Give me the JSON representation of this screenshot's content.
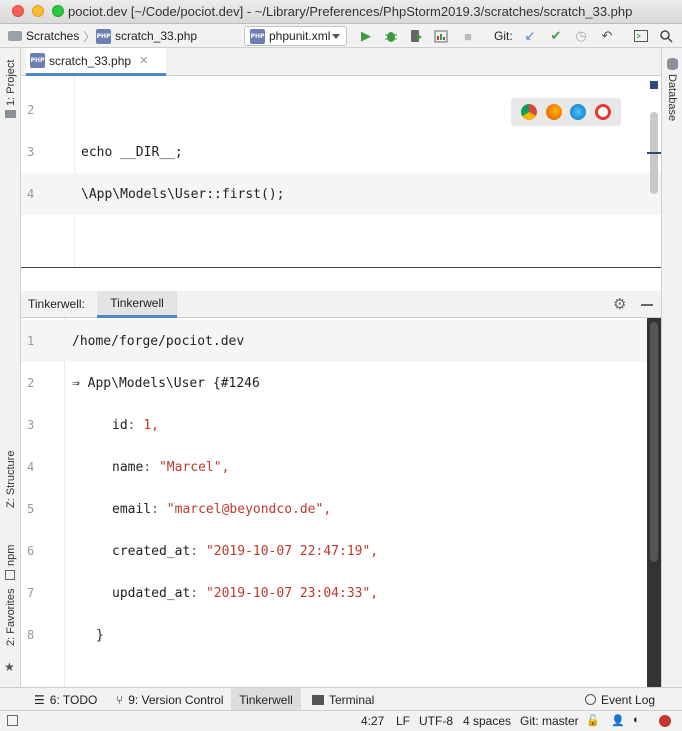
{
  "window": {
    "title": "pociot.dev [~/Code/pociot.dev] - ~/Library/Preferences/PhpStorm2019.3/scratches/scratch_33.php"
  },
  "navbar": {
    "crumb_scratches": "Scratches",
    "crumb_file": "scratch_33.php",
    "run_config": "phpunit.xml",
    "git_label": "Git:"
  },
  "sidebar_left": {
    "project": "1: Project",
    "structure": "Z: Structure",
    "npm": "npm",
    "favorites": "2: Favorites"
  },
  "sidebar_right": {
    "database": "Database"
  },
  "editor": {
    "tab_label": "scratch_33.php",
    "lines": [
      {
        "num": "2",
        "text": ""
      },
      {
        "num": "3",
        "text": "echo __DIR__;"
      },
      {
        "num": "4",
        "text": "\\App\\Models\\User::first();"
      }
    ]
  },
  "tool_window": {
    "header_label": "Tinkerwell:",
    "tab_label": "Tinkerwell",
    "lines": [
      {
        "num": "1",
        "text": "/home/forge/pociot.dev"
      },
      {
        "num": "2",
        "text": "⇒ App\\Models\\User {#1246"
      },
      {
        "num": "3",
        "key": "id",
        "value": "1,"
      },
      {
        "num": "4",
        "key": "name",
        "value": "\"Marcel\","
      },
      {
        "num": "5",
        "key": "email",
        "value": "\"marcel@beyondco.de\","
      },
      {
        "num": "6",
        "key": "created_at",
        "value": "\"2019-10-07 22:47:19\","
      },
      {
        "num": "7",
        "key": "updated_at",
        "value": "\"2019-10-07 23:04:33\","
      },
      {
        "num": "8",
        "text": "}"
      }
    ]
  },
  "bottom_tabs": {
    "todo": "6: TODO",
    "vcs": "9: Version Control",
    "tinkerwell": "Tinkerwell",
    "terminal": "Terminal",
    "event_log": "Event Log"
  },
  "statusbar": {
    "position": "4:27",
    "line_ending": "LF",
    "encoding": "UTF-8",
    "indent": "4 spaces",
    "git_branch": "Git: master"
  },
  "colors": {
    "accent": "#4a88c7",
    "run_green": "#3c9b3c",
    "string_red": "#c0392b"
  }
}
